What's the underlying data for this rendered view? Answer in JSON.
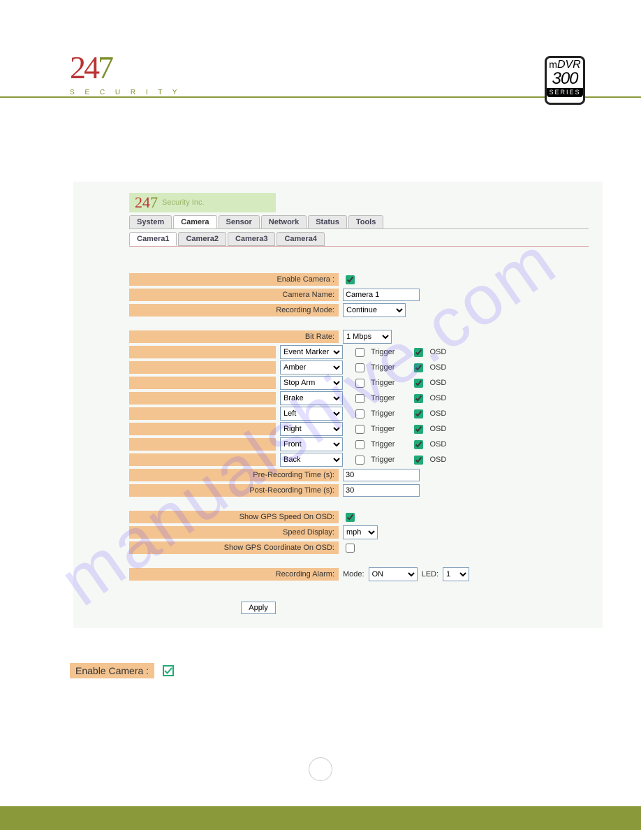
{
  "header": {
    "logo_24": "24",
    "logo_7": "7",
    "logo_subtitle": "S E C U R I T Y",
    "badge_m": "m",
    "badge_dvr": "DVR",
    "badge_num": "300",
    "badge_series": "SERIES"
  },
  "watermark": "manualshive.com",
  "screenshot": {
    "brand_24": "24",
    "brand_7": "7",
    "brand_text": "Security Inc.",
    "main_tabs": [
      "System",
      "Camera",
      "Sensor",
      "Network",
      "Status",
      "Tools"
    ],
    "main_tab_active": 1,
    "sub_tabs": [
      "Camera1",
      "Camera2",
      "Camera3",
      "Camera4"
    ],
    "sub_tab_active": 0,
    "rows": {
      "enable_camera_label": "Enable Camera :",
      "enable_camera_checked": true,
      "camera_name_label": "Camera Name:",
      "camera_name_value": "Camera 1",
      "recording_mode_label": "Recording Mode:",
      "recording_mode_value": "Continue",
      "bit_rate_label": "Bit Rate:",
      "bit_rate_value": "1 Mbps",
      "pre_rec_label": "Pre-Recording Time (s):",
      "pre_rec_value": "30",
      "post_rec_label": "Post-Recording Time (s):",
      "post_rec_value": "30",
      "gps_speed_label": "Show GPS Speed On OSD:",
      "gps_speed_checked": true,
      "speed_display_label": "Speed Display:",
      "speed_display_value": "mph",
      "gps_coord_label": "Show GPS Coordinate On OSD:",
      "gps_coord_checked": false,
      "recording_alarm_label": "Recording Alarm:",
      "recording_alarm_mode_label": "Mode:",
      "recording_alarm_mode_value": "ON",
      "recording_alarm_led_label": "LED:",
      "recording_alarm_led_value": "1"
    },
    "trigger_label": "Trigger",
    "osd_label": "OSD",
    "sensors": [
      {
        "name": "Event Marker",
        "trigger": false,
        "osd": true
      },
      {
        "name": "Amber",
        "trigger": false,
        "osd": true
      },
      {
        "name": "Stop Arm",
        "trigger": false,
        "osd": true
      },
      {
        "name": "Brake",
        "trigger": false,
        "osd": true
      },
      {
        "name": "Left",
        "trigger": false,
        "osd": true
      },
      {
        "name": "Right",
        "trigger": false,
        "osd": true
      },
      {
        "name": "Front",
        "trigger": false,
        "osd": true
      },
      {
        "name": "Back",
        "trigger": false,
        "osd": true
      }
    ],
    "apply_button": "Apply"
  },
  "callout": {
    "label": "Enable Camera :",
    "checked": true
  }
}
